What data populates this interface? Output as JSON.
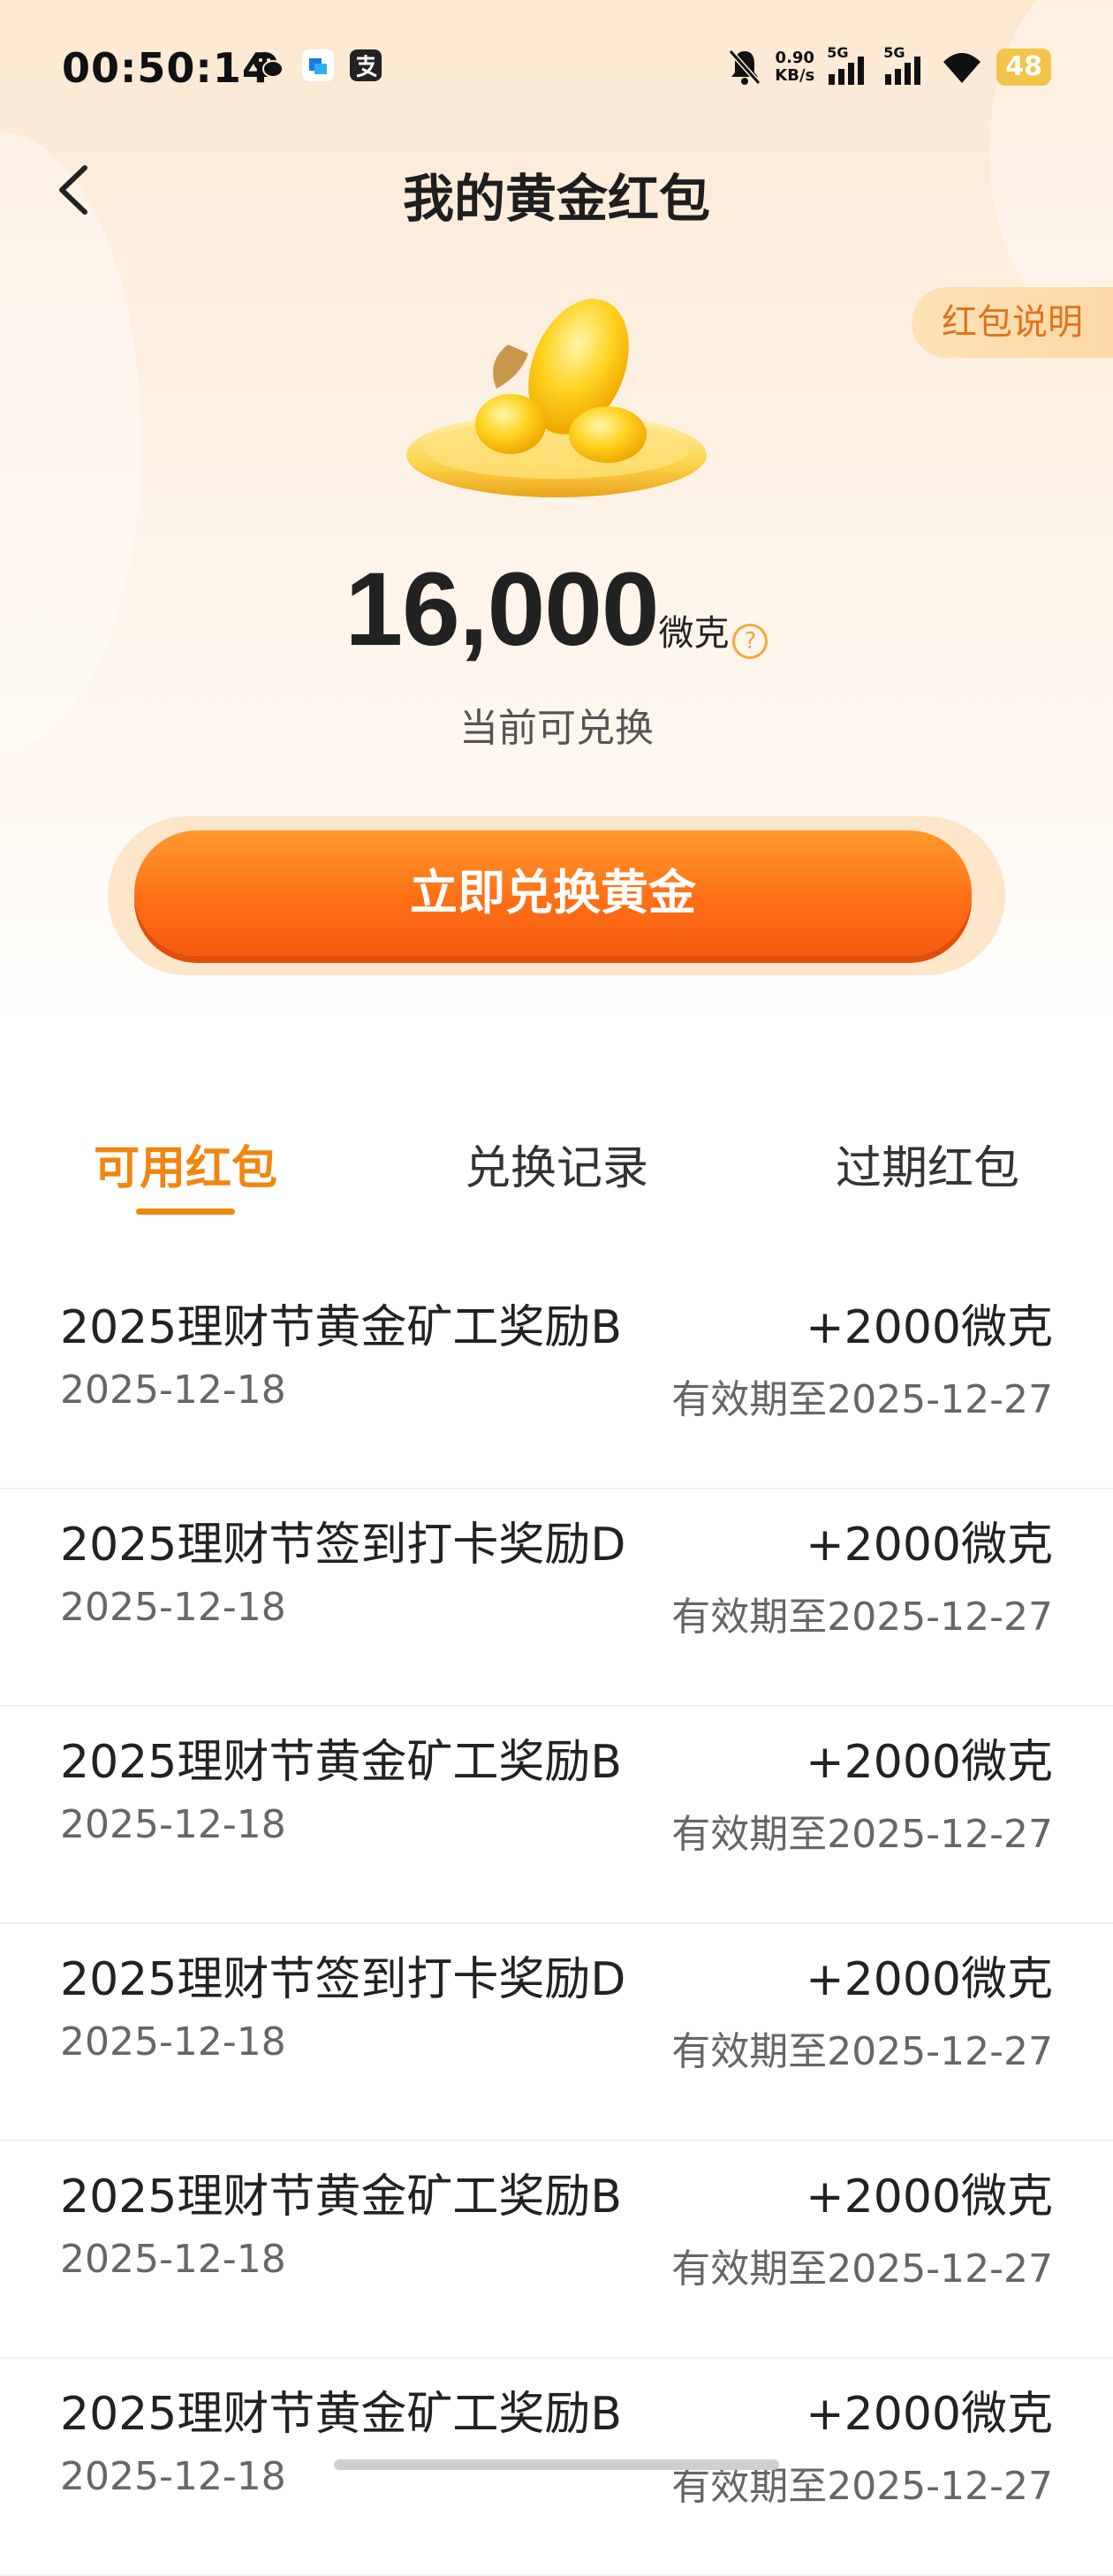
{
  "status_bar": {
    "time": "00:50:14",
    "net_speed_value": "0.90",
    "net_speed_unit": "KB/s",
    "signal1": "5G",
    "signal2": "5G",
    "battery": "48"
  },
  "header": {
    "title": "我的黄金红包",
    "explain_label": "红包说明"
  },
  "balance": {
    "amount": "16,000",
    "unit": "微克",
    "help_symbol": "?",
    "sub_label": "当前可兑换"
  },
  "redeem_button": {
    "label": "立即兑换黄金"
  },
  "tabs": [
    {
      "label": "可用红包",
      "active": true
    },
    {
      "label": "兑换记录",
      "active": false
    },
    {
      "label": "过期红包",
      "active": false
    }
  ],
  "items": [
    {
      "title": "2025理财节黄金矿工奖励B",
      "amount": "+2000微克",
      "date": "2025-12-18",
      "expiry": "有效期至2025-12-27"
    },
    {
      "title": "2025理财节签到打卡奖励D",
      "amount": "+2000微克",
      "date": "2025-12-18",
      "expiry": "有效期至2025-12-27"
    },
    {
      "title": "2025理财节黄金矿工奖励B",
      "amount": "+2000微克",
      "date": "2025-12-18",
      "expiry": "有效期至2025-12-27"
    },
    {
      "title": "2025理财节签到打卡奖励D",
      "amount": "+2000微克",
      "date": "2025-12-18",
      "expiry": "有效期至2025-12-27"
    },
    {
      "title": "2025理财节黄金矿工奖励B",
      "amount": "+2000微克",
      "date": "2025-12-18",
      "expiry": "有效期至2025-12-27"
    },
    {
      "title": "2025理财节黄金矿工奖励B",
      "amount": "+2000微克",
      "date": "2025-12-18",
      "expiry": "有效期至2025-12-27"
    }
  ],
  "colors": {
    "accent": "#f0860f",
    "button": "#ff7a1c",
    "battery": "#f3c44a"
  }
}
